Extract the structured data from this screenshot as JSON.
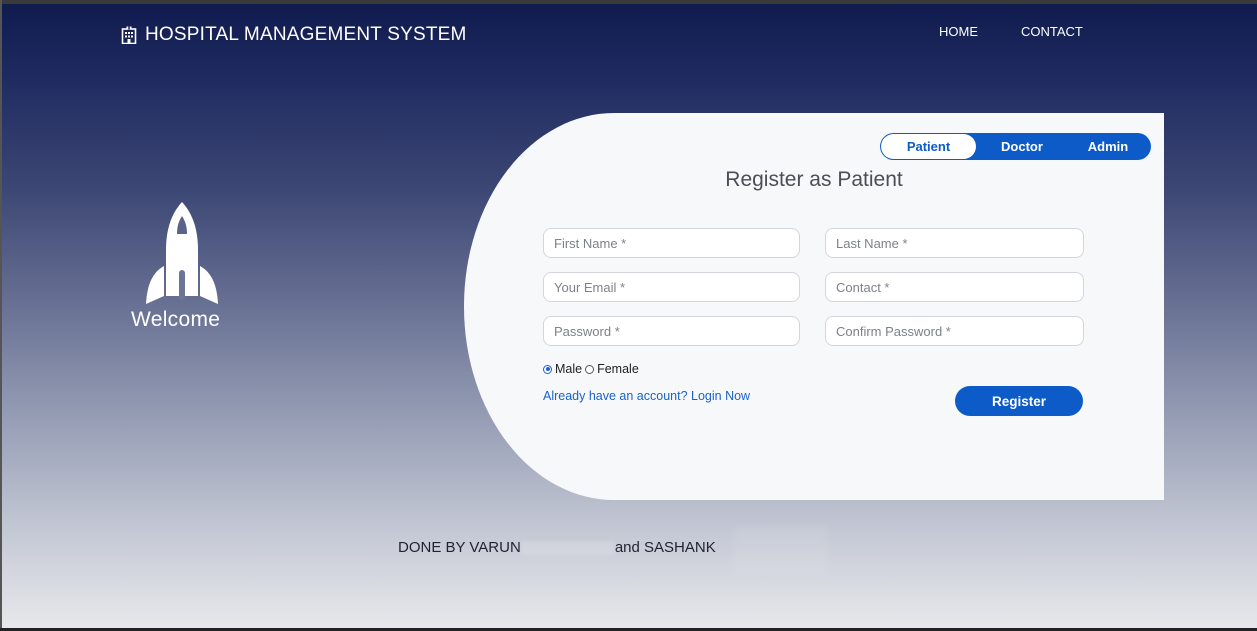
{
  "navbar": {
    "brand_icon": "hospital-building-icon",
    "brand_title": "HOSPITAL MANAGEMENT SYSTEM",
    "links": {
      "home": "HOME",
      "contact": "CONTACT"
    }
  },
  "hero": {
    "icon": "rocket-icon",
    "welcome_text": "Welcome"
  },
  "form": {
    "tabs": {
      "patient": "Patient",
      "doctor": "Doctor",
      "admin": "Admin",
      "active": "Patient"
    },
    "title": "Register as Patient",
    "fields": {
      "first_name": {
        "placeholder": "First Name *",
        "value": ""
      },
      "last_name": {
        "placeholder": "Last Name *",
        "value": ""
      },
      "email": {
        "placeholder": "Your Email *",
        "value": ""
      },
      "contact": {
        "placeholder": "Contact *",
        "value": ""
      },
      "password": {
        "placeholder": "Password *",
        "value": ""
      },
      "confirm_password": {
        "placeholder": "Confirm Password *",
        "value": ""
      }
    },
    "gender": {
      "male": "Male",
      "female": "Female",
      "selected": "Male"
    },
    "login_link": "Already have an account? Login Now",
    "register_button": "Register"
  },
  "footer": {
    "part1": "DONE BY VARUN",
    "part2": "and SASHANK"
  },
  "colors": {
    "accent": "#0d5bc9",
    "navbar_bg": "#0f1a4d",
    "card_bg": "#f7f8fa",
    "link": "#1a62c9"
  }
}
